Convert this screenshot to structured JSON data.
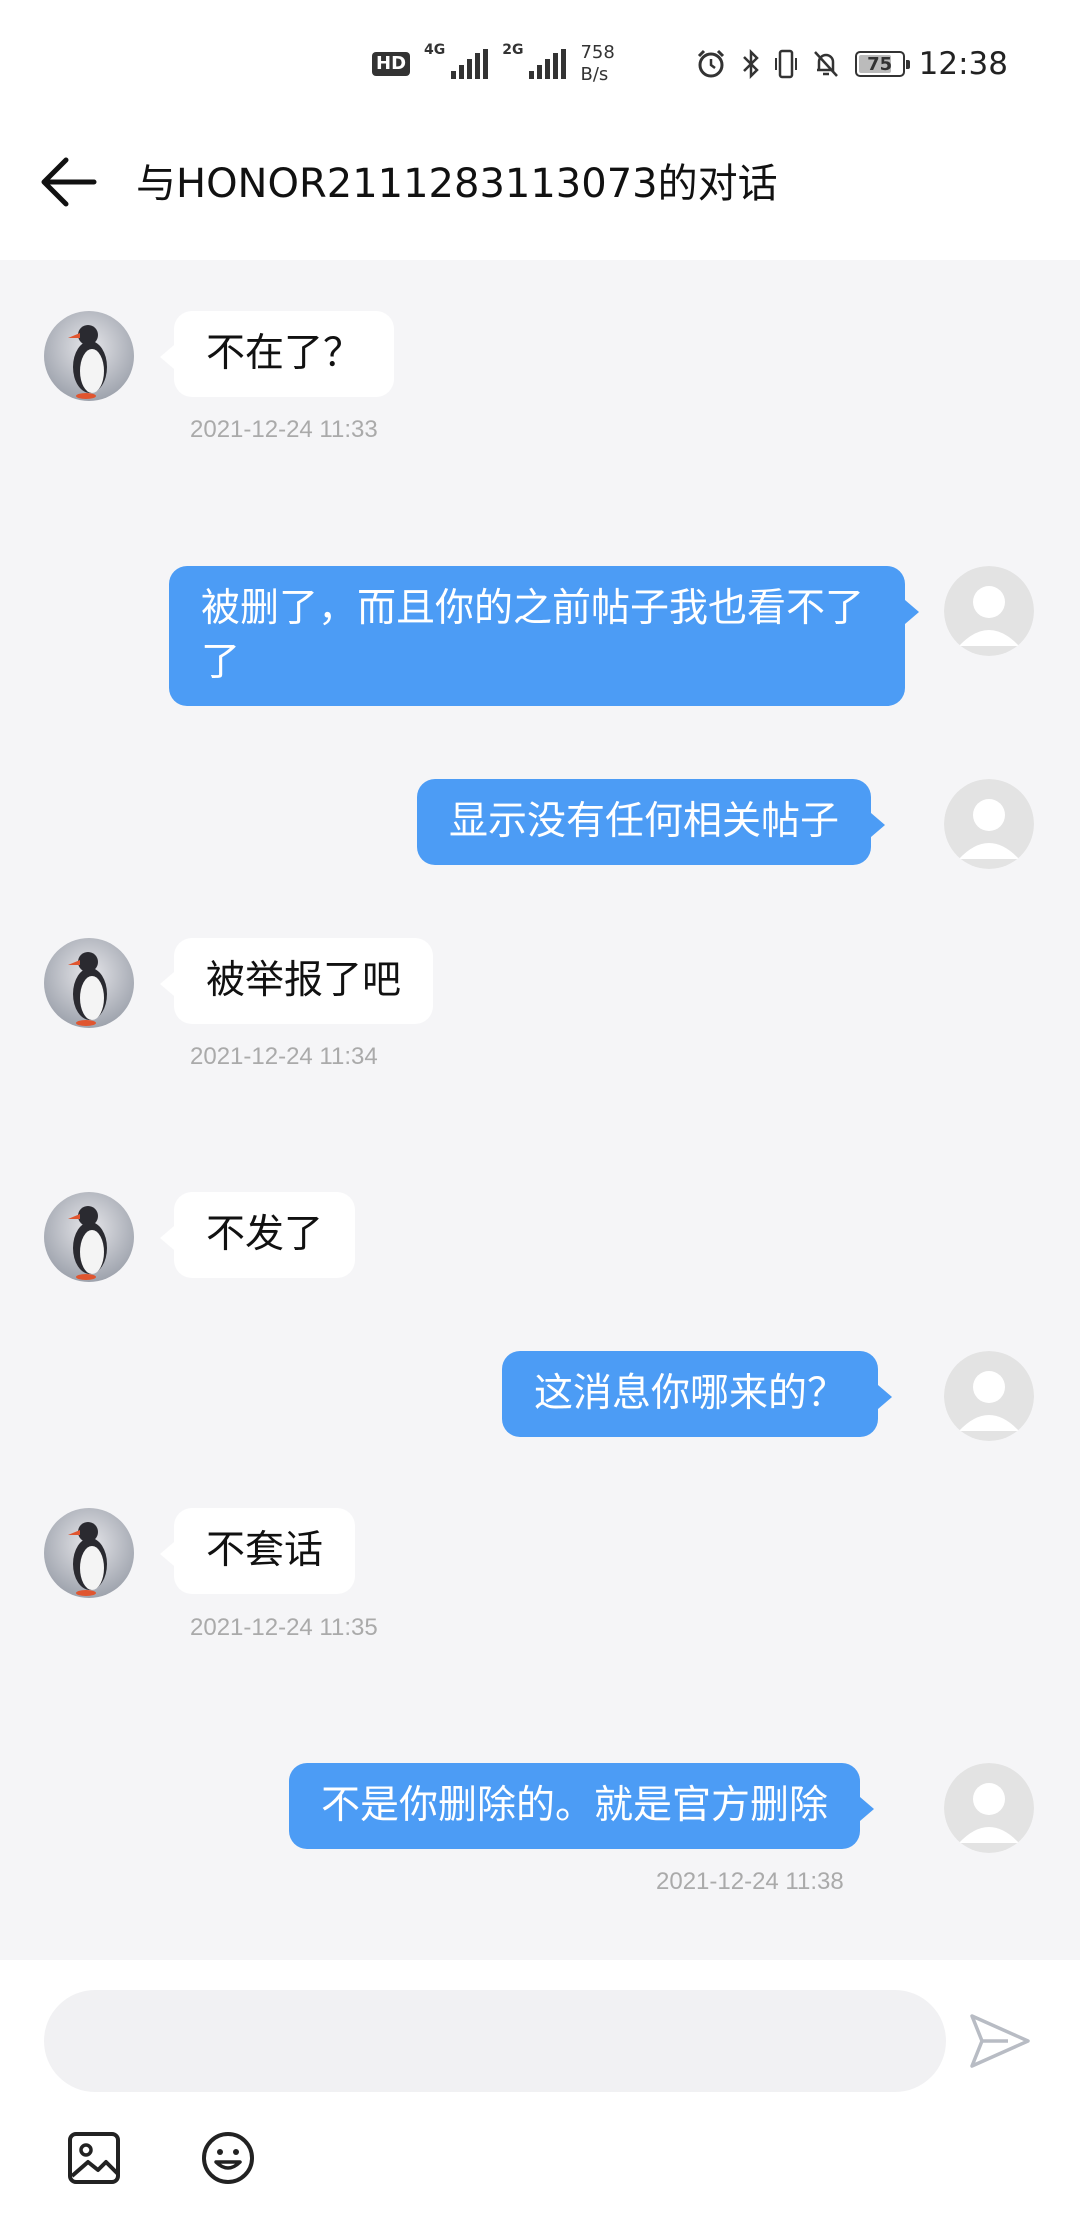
{
  "status_bar": {
    "hd": "HD",
    "net1": "4G",
    "net2": "2G",
    "speed_value": "758",
    "speed_unit": "B/s",
    "battery": "75",
    "time": "12:38"
  },
  "header": {
    "title": "与HONOR2111283113073的对话"
  },
  "messages": [
    {
      "side": "left",
      "text": "不在了？",
      "time": "2021-12-24 11:33"
    },
    {
      "side": "right",
      "text": "被删了，而且你的之前帖子我也看不了了"
    },
    {
      "side": "right",
      "text": "显示没有任何相关帖子"
    },
    {
      "side": "left",
      "text": "被举报了吧",
      "time": "2021-12-24 11:34"
    },
    {
      "side": "left",
      "text": "不发了"
    },
    {
      "side": "right",
      "text": "这消息你哪来的？"
    },
    {
      "side": "left",
      "text": "不套话",
      "time": "2021-12-24 11:35"
    },
    {
      "side": "right",
      "text": "不是你删除的。就是官方删除",
      "time": "2021-12-24 11:38"
    }
  ],
  "input": {
    "placeholder": ""
  },
  "colors": {
    "accent": "#4c9cf5",
    "chat_bg": "#f5f5f7",
    "timestamp": "#aaaaaa"
  },
  "icons": {
    "back": "arrow-left-icon",
    "send": "send-icon",
    "image": "image-icon",
    "emoji": "emoji-icon"
  }
}
